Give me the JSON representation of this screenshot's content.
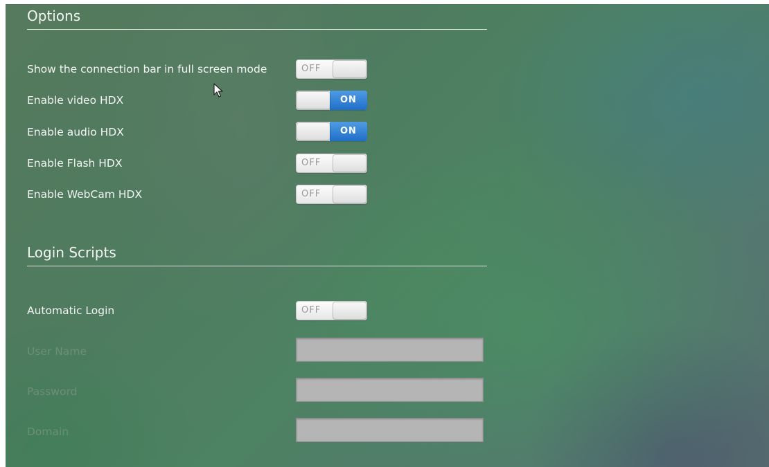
{
  "options": {
    "title": "Options",
    "rows": [
      {
        "label": "Show the connection bar in full screen mode",
        "state": "OFF"
      },
      {
        "label": "Enable video HDX",
        "state": "ON"
      },
      {
        "label": "Enable audio HDX",
        "state": "ON"
      },
      {
        "label": "Enable Flash HDX",
        "state": "OFF"
      },
      {
        "label": "Enable WebCam HDX",
        "state": "OFF"
      }
    ]
  },
  "login_scripts": {
    "title": "Login Scripts",
    "automatic_login": {
      "label": "Automatic Login",
      "state": "OFF"
    },
    "fields": [
      {
        "label": "User Name",
        "value": ""
      },
      {
        "label": "Password",
        "value": ""
      },
      {
        "label": "Domain",
        "value": ""
      }
    ]
  },
  "colors": {
    "toggle_on_accent": "#2f7fd6",
    "field_disabled": "#b5b5b5"
  },
  "icons": {
    "cursor": "mouse-pointer-icon"
  }
}
